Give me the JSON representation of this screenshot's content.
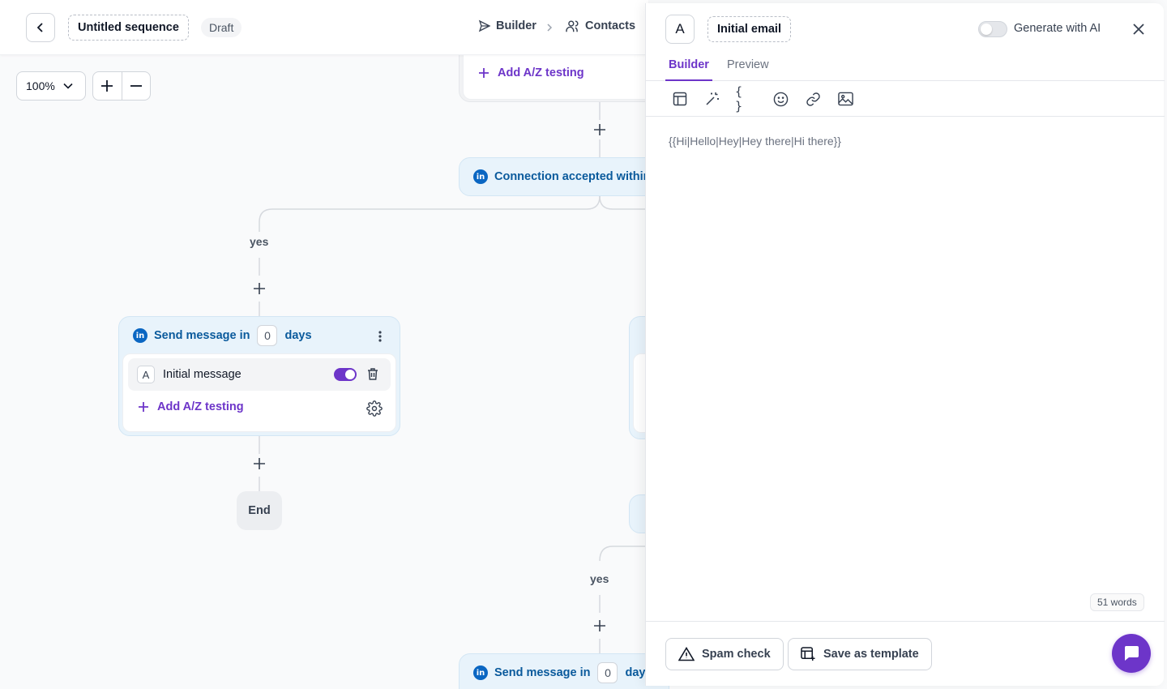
{
  "header": {
    "sequence_name": "Untitled sequence",
    "status": "Draft",
    "nav": {
      "builder": "Builder",
      "contacts": "Contacts"
    }
  },
  "zoom": {
    "level": "100%"
  },
  "canvas": {
    "top_card": {
      "az_label": "Add A/Z testing"
    },
    "connection_step": {
      "title": "Connection accepted within"
    },
    "yes_left": "yes",
    "yes_right": "yes",
    "message_step": {
      "title_prefix": "Send message in",
      "days": "0",
      "title_suffix": "days",
      "variant_letter": "A",
      "variant_name": "Initial message",
      "variant_enabled": true,
      "az_label": "Add A/Z testing"
    },
    "end_label": "End",
    "bottom_step": {
      "title_prefix": "Send message in",
      "days": "0",
      "title_suffix": "days"
    }
  },
  "panel": {
    "variant_letter": "A",
    "title": "Initial email",
    "ai_label": "Generate with AI",
    "ai_enabled": false,
    "tabs": [
      {
        "label": "Builder",
        "active": true
      },
      {
        "label": "Preview",
        "active": false
      }
    ],
    "toolbar": [
      "template-icon",
      "magic-wand-icon",
      "variable-icon",
      "emoji-icon",
      "link-icon",
      "image-icon"
    ],
    "variable_glyph": "{ }",
    "editor_text": "{{Hi|Hello|Hey|Hey there|Hi there}}",
    "word_count": "51 words",
    "spam_check_label": "Spam check",
    "save_template_label": "Save as template"
  },
  "colors": {
    "accent": "#6d35c9",
    "linkedin": "#0a66c2",
    "step_bg": "#e8f3fb",
    "step_text": "#0a5a9c"
  }
}
